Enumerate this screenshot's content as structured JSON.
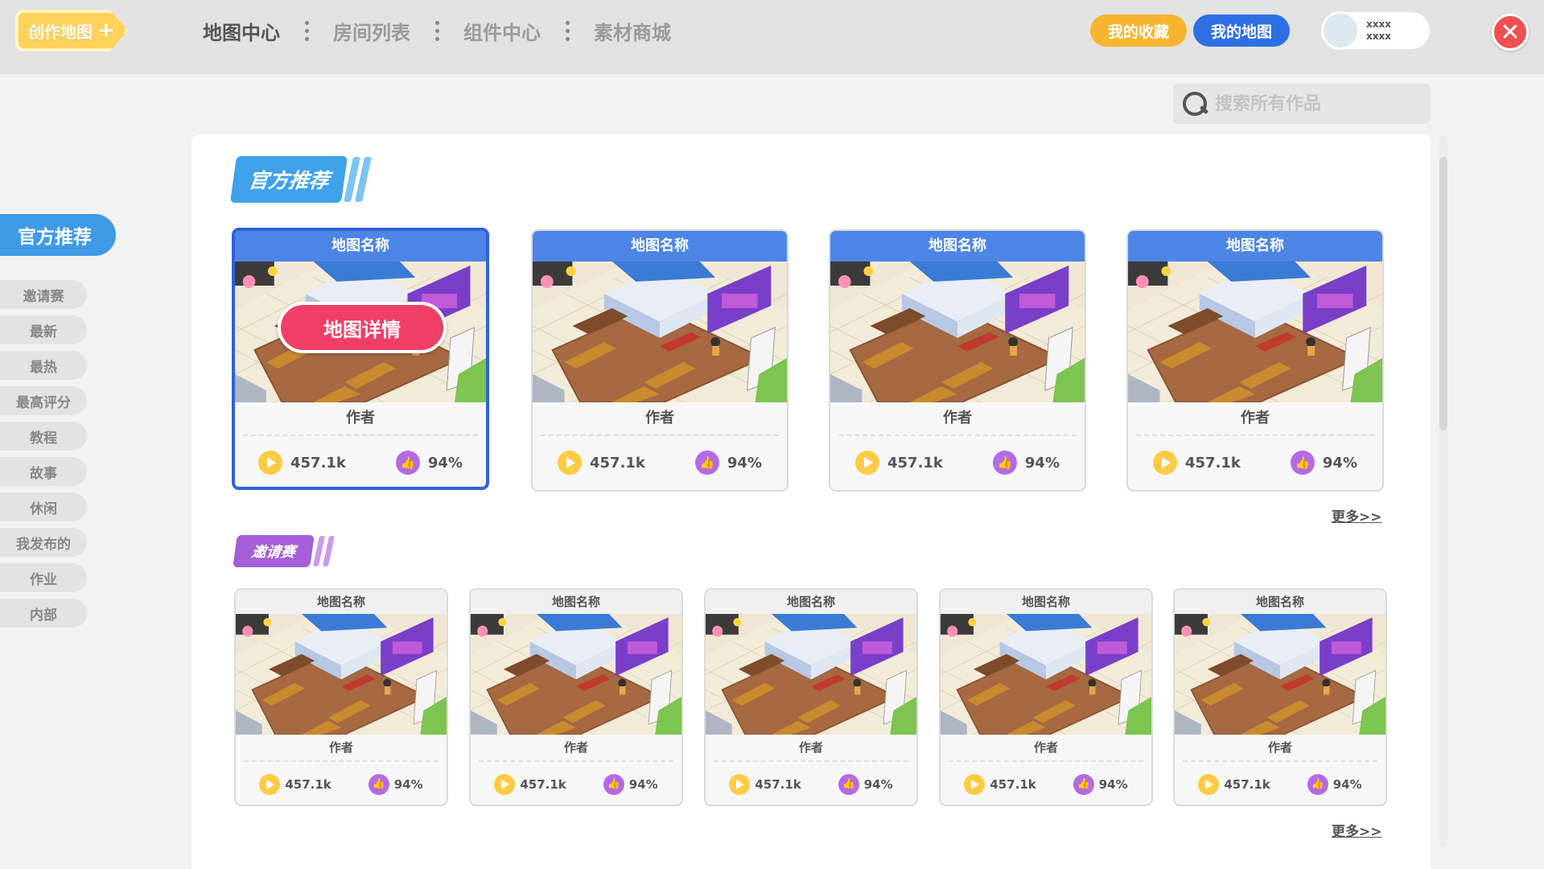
{
  "header": {
    "create_label": "创作地图",
    "nav": [
      "地图中心",
      "房间列表",
      "组件中心",
      "素材商城"
    ],
    "active_nav": "地图中心",
    "favorites_label": "我的收藏",
    "my_maps_label": "我的地图",
    "user_line1": "xxxx",
    "user_line2": "xxxx"
  },
  "search": {
    "placeholder": "搜索所有作品",
    "value": ""
  },
  "sidebar": {
    "active": "官方推荐",
    "items": [
      "邀请赛",
      "最新",
      "最热",
      "最高评分",
      "教程",
      "故事",
      "休闲",
      "我发布的",
      "作业",
      "内部"
    ]
  },
  "sections": {
    "official": {
      "title": "官方推荐",
      "detail_button": "地图详情",
      "more": "更多>>",
      "cards": [
        {
          "title": "地图名称",
          "author": "作者",
          "plays": "457.1k",
          "rating": "94%"
        },
        {
          "title": "地图名称",
          "author": "作者",
          "plays": "457.1k",
          "rating": "94%"
        },
        {
          "title": "地图名称",
          "author": "作者",
          "plays": "457.1k",
          "rating": "94%"
        },
        {
          "title": "地图名称",
          "author": "作者",
          "plays": "457.1k",
          "rating": "94%"
        }
      ]
    },
    "invite": {
      "title": "邀请赛",
      "more": "更多>>",
      "cards": [
        {
          "title": "地图名称",
          "author": "作者",
          "plays": "457.1k",
          "rating": "94%"
        },
        {
          "title": "地图名称",
          "author": "作者",
          "plays": "457.1k",
          "rating": "94%"
        },
        {
          "title": "地图名称",
          "author": "作者",
          "plays": "457.1k",
          "rating": "94%"
        },
        {
          "title": "地图名称",
          "author": "作者",
          "plays": "457.1k",
          "rating": "94%"
        },
        {
          "title": "地图名称",
          "author": "作者",
          "plays": "457.1k",
          "rating": "94%"
        }
      ]
    }
  },
  "colors": {
    "create": "#ffd35a",
    "favorites": "#f7b52f",
    "my_maps": "#2f6fe4",
    "close": "#f05050",
    "sidebar_active": "#3f9be6",
    "official_banner": "#3fa2ea",
    "invite_banner": "#a55fd9",
    "card_header": "#4d85e6",
    "detail_button": "#ef3f66",
    "play_icon": "#ffcb45",
    "like_icon": "#b46ae8"
  },
  "icons": [
    "plus-icon",
    "close-icon",
    "search-icon",
    "play-icon",
    "thumbs-up-icon",
    "avatar"
  ]
}
